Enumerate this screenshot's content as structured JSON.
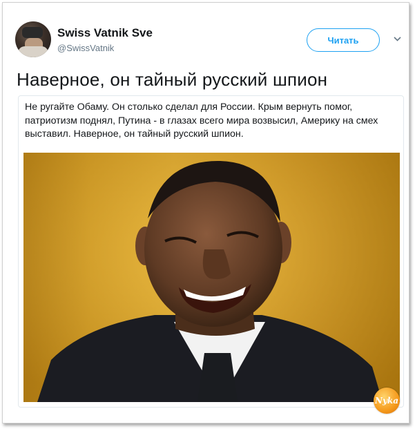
{
  "author": {
    "display_name": "Swiss Vatnik Sve",
    "handle": "@SwissVatnik"
  },
  "follow_button_label": "Читать",
  "tweet": {
    "title": "Наверное, он тайный русский шпион",
    "card_text": "Не ругайте Обаму. Он столько сделал для России. Крым вернуть помог, патриотизм поднял, Путина - в глазах всего мира возвысил, Америку на смех выставил. Наверное, он тайный русский шпион."
  },
  "watermark": "Nyka",
  "icons": {
    "menu": "chevron-down-icon"
  },
  "colors": {
    "accent": "#1da1f2",
    "text": "#14171a",
    "muted": "#657786"
  }
}
